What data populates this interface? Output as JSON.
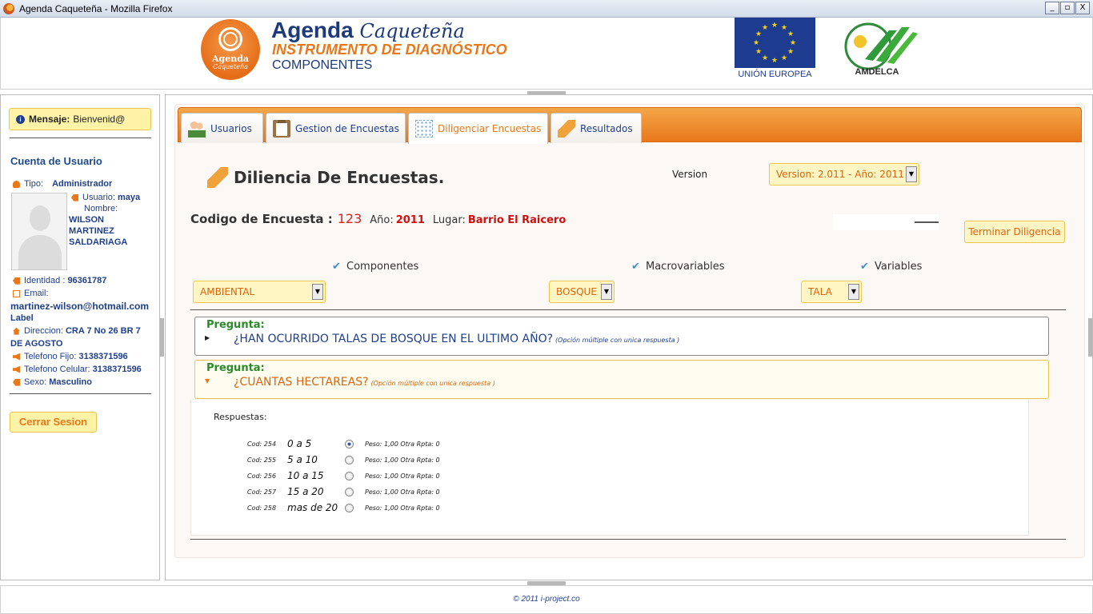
{
  "window": {
    "title": "Agenda Caqueteña - Mozilla Firefox",
    "min": "_",
    "max": "▫",
    "close": "X"
  },
  "header": {
    "logo_word": "Agenda",
    "logo_sub": "Caqueteña",
    "brand_main": "Agenda",
    "brand_italic": "Caqueteña",
    "subtitle": "INSTRUMENTO DE DIAGNÓSTICO",
    "section": "COMPONENTES",
    "eu_label": "UNIÓN EUROPEA",
    "partner_label": "AMDELCA"
  },
  "sidebar": {
    "message_label": "Mensaje:",
    "message_value": "Bienvenid@",
    "account_title": "Cuenta de Usuario",
    "type_label": "Tipo:",
    "type_value": "Administrador",
    "user_label": "Usuario:",
    "user_value": "maya",
    "name_label": "Nombre:",
    "name_line1": "WILSON",
    "name_line2": "MARTINEZ",
    "name_line3": "SALDARIAGA",
    "id_label": "Identidad :",
    "id_value": "96361787",
    "email_label": "Email:",
    "email_value": "martinez-wilson@hotmail.com",
    "email_extra": "Label",
    "address_label": "Direccion:",
    "address_line1": "CRA 7 No 26 BR 7",
    "address_line2": "DE AGOSTO",
    "phone_label": "Telefono Fijo:",
    "phone_value": "3138371596",
    "mobile_label": "Telefono Celular:",
    "mobile_value": "3138371596",
    "sex_label": "Sexo:",
    "sex_value": "Masculino",
    "logout": "Cerrar Sesion"
  },
  "tabs": [
    {
      "label": "Usuarios",
      "icon": "users-icon",
      "active": false
    },
    {
      "label": "Gestion de Encuestas",
      "icon": "clipboard-icon",
      "active": false
    },
    {
      "label": "Diligenciar Encuestas",
      "icon": "grid-icon",
      "active": true
    },
    {
      "label": "Resultados",
      "icon": "pencil-icon",
      "active": false
    }
  ],
  "form": {
    "title": "Diliencia De Encuestas.",
    "version_label": "Version",
    "version_value": "Version: 2.011 - Año: 2011",
    "code_label": "Codigo de Encuesta :",
    "code_value": "123",
    "year_label": "Año:",
    "year_value": "2011",
    "place_label": "Lugar:",
    "place_value": "Barrio El Raicero",
    "finish_button": "Terminar Diligencia",
    "filters": {
      "components_label": "Componentes",
      "components_value": "AMBIENTAL",
      "macro_label": "Macrovariables",
      "macro_value": "BOSQUE",
      "variables_label": "Variables",
      "variables_value": "TALA"
    }
  },
  "questions": [
    {
      "prefix": "Pregunta:",
      "text": "¿HAN OCURRIDO TALAS DE BOSQUE EN EL ULTIMO AÑO?",
      "type": "(Opción múltiple con unica respuesta )"
    },
    {
      "prefix": "Pregunta:",
      "text": "¿CUANTAS HECTAREAS?",
      "type": "(Opción múltiple con unica respuesta )"
    }
  ],
  "answers": {
    "label": "Respuestas:",
    "items": [
      {
        "cod": "Cod: 254",
        "value": "0 a 5",
        "selected": true,
        "peso": "Peso: 1,00 Otra Rpta: 0"
      },
      {
        "cod": "Cod: 255",
        "value": "5 a 10",
        "selected": false,
        "peso": "Peso: 1,00 Otra Rpta: 0"
      },
      {
        "cod": "Cod: 256",
        "value": "10 a 15",
        "selected": false,
        "peso": "Peso: 1,00 Otra Rpta: 0"
      },
      {
        "cod": "Cod: 257",
        "value": "15 a 20",
        "selected": false,
        "peso": "Peso: 1,00 Otra Rpta: 0"
      },
      {
        "cod": "Cod: 258",
        "value": "mas de 20",
        "selected": false,
        "peso": "Peso: 1,00 Otra Rpta: 0"
      }
    ]
  },
  "footer": {
    "text": "© 2011 i-project.co"
  },
  "colors": {
    "accent": "#e8781a",
    "navy": "#1f3f8a",
    "highlight": "#fff6c4"
  }
}
